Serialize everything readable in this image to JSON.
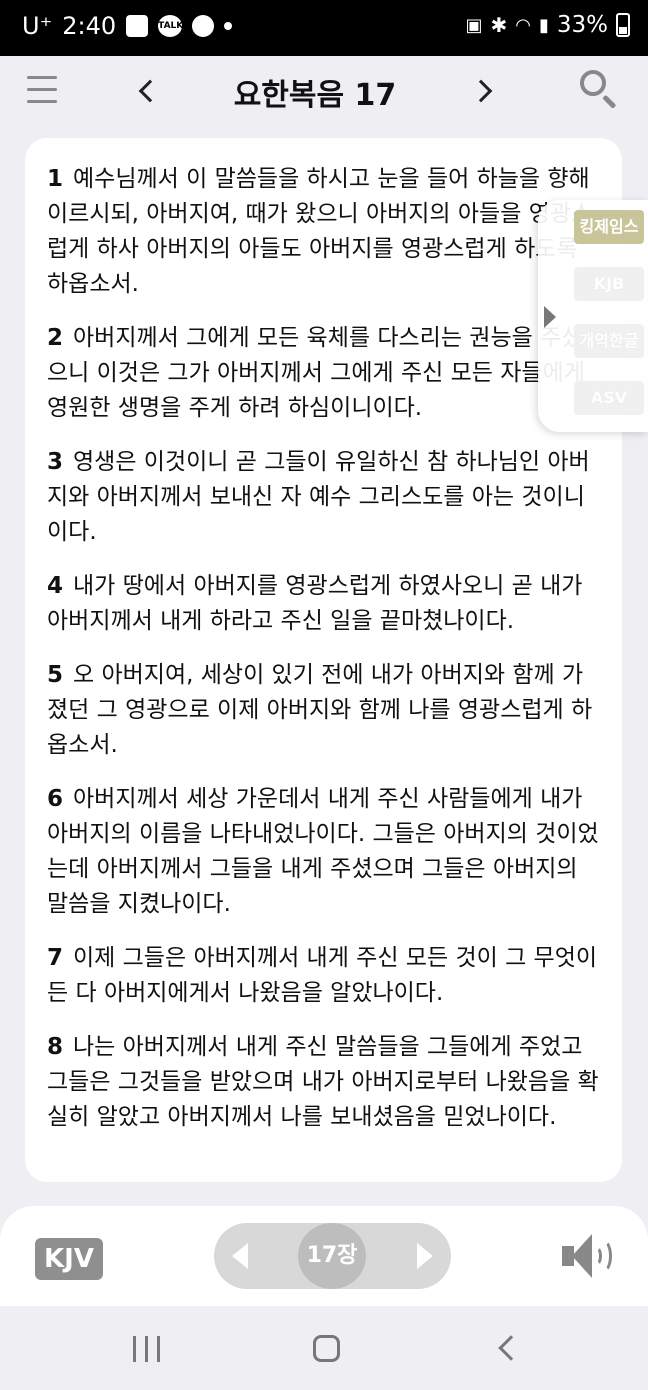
{
  "status_bar": {
    "carrier": "U⁺",
    "time": "2:40",
    "notif_talk": "TALK",
    "battery_percent": "33%"
  },
  "header": {
    "title": "요한복음 17"
  },
  "verses": [
    {
      "num": "1",
      "text": "예수님께서 이 말씀들을 하시고 눈을 들어 하늘을 향해 이르시되, 아버지여, 때가 왔으니 아버지의 아들을 영광스럽게 하사 아버지의 아들도 아버지를 영광스럽게 하도록 하옵소서."
    },
    {
      "num": "2",
      "text": "아버지께서 그에게 모든 육체를 다스리는 권능을 주셨으니 이것은 그가 아버지께서 그에게 주신 모든 자들에게 영원한 생명을 주게 하려 하심이니이다."
    },
    {
      "num": "3",
      "text": "영생은 이것이니 곧 그들이 유일하신 참 하나님인 아버지와 아버지께서 보내신 자 예수 그리스도를 아는 것이니이다."
    },
    {
      "num": "4",
      "text": "내가 땅에서 아버지를 영광스럽게 하였사오니 곧 내가 아버지께서 내게 하라고 주신 일을 끝마쳤나이다."
    },
    {
      "num": "5",
      "text": "오 아버지여, 세상이 있기 전에 내가 아버지와 함께 가졌던 그 영광으로 이제 아버지와 함께 나를 영광스럽게 하옵소서."
    },
    {
      "num": "6",
      "text": "아버지께서 세상 가운데서 내게 주신 사람들에게 내가 아버지의 이름을 나타내었나이다. 그들은 아버지의 것이었는데 아버지께서 그들을 내게 주셨으며 그들은 아버지의 말씀을 지켰나이다."
    },
    {
      "num": "7",
      "text": "이제 그들은 아버지께서 내게 주신 모든 것이 그 무엇이든 다 아버지에게서 나왔음을 알았나이다."
    },
    {
      "num": "8",
      "text": "나는 아버지께서 내게 주신 말씀들을 그들에게 주었고 그들은 그것들을 받았으며 내가 아버지로부터 나왔음을 확실히 알았고 아버지께서 나를 보내셨음을 믿었나이다."
    }
  ],
  "versions": [
    {
      "label": "킹제임스",
      "active": true
    },
    {
      "label": "KJB",
      "active": false
    },
    {
      "label": "개역한글",
      "active": false
    },
    {
      "label": "ASV",
      "active": false
    }
  ],
  "bottom": {
    "version_badge": "KJV",
    "chapter_label": "17장"
  },
  "colors": {
    "accent_active": "#c9c59a",
    "badge_gray": "#8f8f8f",
    "background": "#efeef3"
  }
}
